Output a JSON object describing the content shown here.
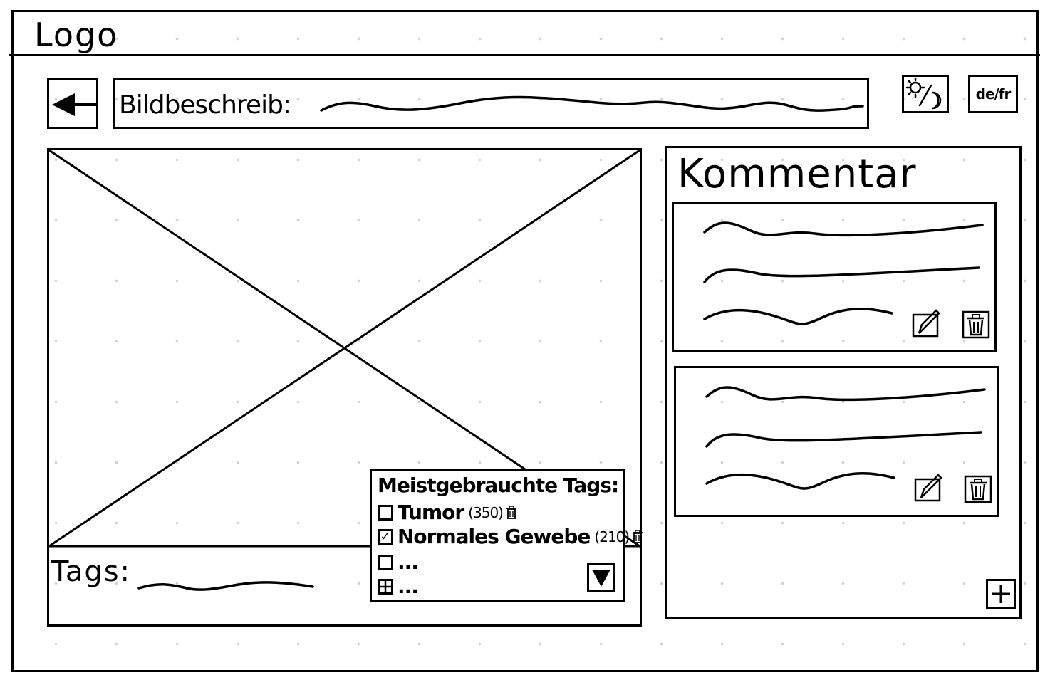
{
  "header": {
    "logo": "Logo"
  },
  "toolbar": {
    "back_icon": "arrow-left-icon",
    "description_label": "Bildbeschreib:",
    "theme_icon": "sun-moon-icon",
    "language_label": "de/fr"
  },
  "image_panel": {
    "image_icon": "image-placeholder",
    "tags_label": "Tags:"
  },
  "tags_dropdown": {
    "title": "Meistgebrauchte Tags:",
    "items": [
      {
        "checked": false,
        "name": "Tumor",
        "count": "(350)",
        "icon": "trash-icon"
      },
      {
        "checked": true,
        "name": "Normales Gewebe",
        "count": "(210)",
        "icon": "trash-icon"
      },
      {
        "checked": false,
        "name": "..."
      }
    ],
    "add_item": {
      "icon": "grid-plus-icon",
      "label": "..."
    },
    "expand_icon": "triangle-down-icon"
  },
  "comments": {
    "title": "Kommentar",
    "cards": [
      {
        "edit_icon": "pencil-icon",
        "delete_icon": "trash-icon"
      },
      {
        "edit_icon": "pencil-icon",
        "delete_icon": "trash-icon"
      }
    ],
    "add_icon": "plus-icon"
  }
}
